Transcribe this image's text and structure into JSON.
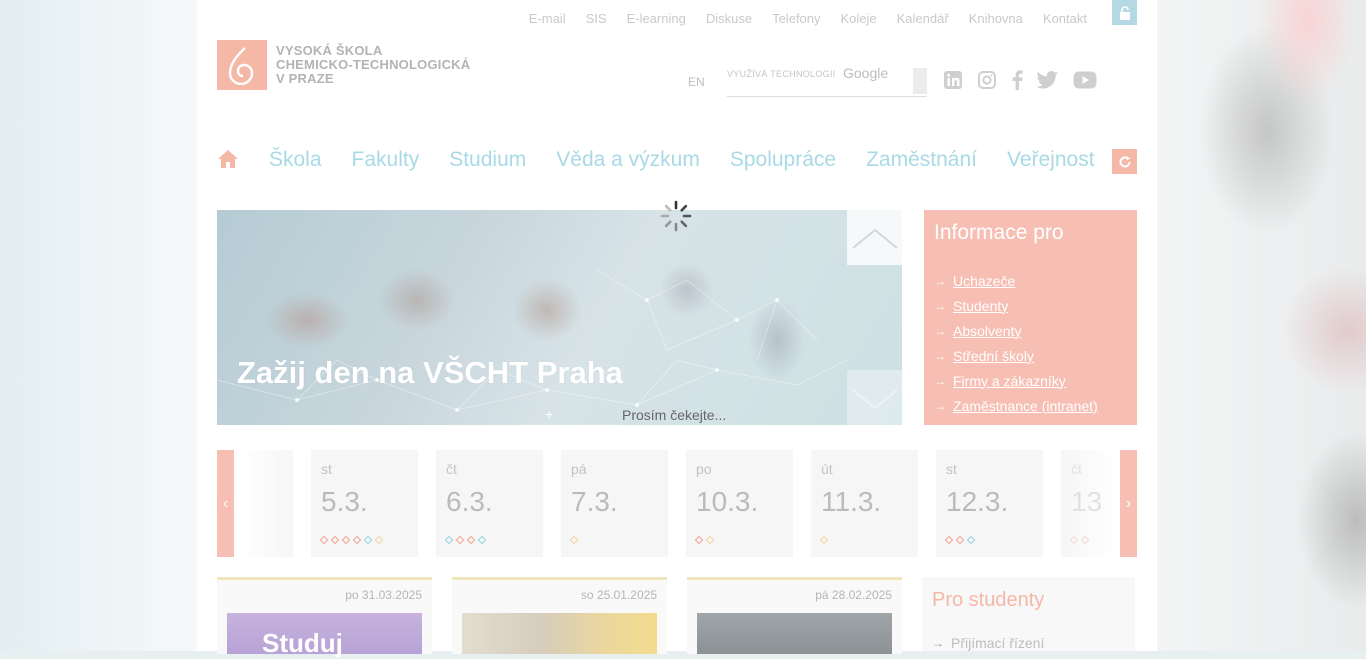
{
  "top_links": [
    "E-mail",
    "SIS",
    "E-learning",
    "Diskuse",
    "Telefony",
    "Koleje",
    "Kalendář",
    "Knihovna",
    "Kontakt"
  ],
  "logo": {
    "line1": "VYSOKÁ ŠKOLA",
    "line2": "CHEMICKO-TECHNOLOGICKÁ",
    "line3": "V PRAZE"
  },
  "lang_switch": "EN",
  "search": {
    "powered": "VYUŽÍVÁ TECHNOLOGII",
    "engine": "Google"
  },
  "main_nav": [
    "Škola",
    "Fakulty",
    "Studium",
    "Věda a výzkum",
    "Spolupráce",
    "Zaměstnání",
    "Veřejnost"
  ],
  "hero": {
    "title": "Zažij den na VŠCHT Praha",
    "plus": "+"
  },
  "loading_text": "Prosím čekejte...",
  "info_box": {
    "title": "Informace pro",
    "links": [
      "Uchazeče",
      "Studenty",
      "Absolventy",
      "Střední školy",
      "Firmy a zákazníky",
      "Zaměstnance (intranet)"
    ]
  },
  "calendar": {
    "prev": "‹",
    "next": "›",
    "days": [
      {
        "weekday": "st",
        "date": "5.3.",
        "dots": [
          "#f5a090",
          "#f5a090",
          "#f5a090",
          "#f5a090",
          "#8fd2e0",
          "#f3d39a"
        ]
      },
      {
        "weekday": "čt",
        "date": "6.3.",
        "dots": [
          "#8fd2e0",
          "#f5a090",
          "#f5a090",
          "#8fd2e0"
        ]
      },
      {
        "weekday": "pá",
        "date": "7.3.",
        "dots": [
          "#f3d39a"
        ]
      },
      {
        "weekday": "po",
        "date": "10.3.",
        "dots": [
          "#f5a090",
          "#f3d39a"
        ]
      },
      {
        "weekday": "út",
        "date": "11.3.",
        "dots": [
          "#f3d39a"
        ]
      },
      {
        "weekday": "st",
        "date": "12.3.",
        "dots": [
          "#f5a090",
          "#f5a090",
          "#8fd2e0"
        ]
      },
      {
        "weekday": "čt",
        "date": "13",
        "dots": [
          "#f5d9d0",
          "#f5d9d0"
        ]
      }
    ]
  },
  "news": [
    {
      "date": "po 31.03.2025",
      "image_text": "Studuj"
    },
    {
      "date": "so 25.01.2025",
      "image_text": ""
    },
    {
      "date": "pá 28.02.2025",
      "image_text": ""
    }
  ],
  "students_box": {
    "title": "Pro studenty",
    "first_item": "Přijímací řízení"
  },
  "colors": {
    "accent": "#f7beb3",
    "nav": "#a8dae6",
    "lock": "#b5d9e4"
  }
}
